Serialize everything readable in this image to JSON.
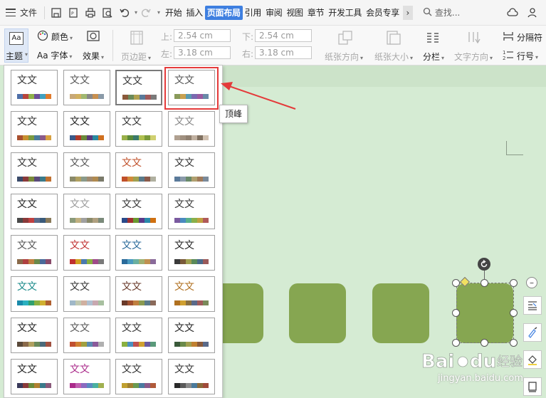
{
  "menubar": {
    "file_label": "文件",
    "tabs": [
      "开始",
      "插入",
      "页面布局",
      "引用",
      "审阅",
      "视图",
      "章节",
      "开发工具",
      "会员专享"
    ],
    "active_tab": "页面布局",
    "search_label": "查找..."
  },
  "ribbon": {
    "theme_icon_text": "Aa",
    "theme_label": "主题",
    "color_label": "颜色",
    "font_label": "字体",
    "font_prefix": "Aa",
    "effect_label": "效果",
    "margins_label": "页边距",
    "margin_top_label": "上:",
    "margin_top_value": "2.54 cm",
    "margin_left_label": "左:",
    "margin_left_value": "3.18 cm",
    "margin_bottom_label": "下:",
    "margin_bottom_value": "2.54 cm",
    "margin_right_label": "右:",
    "margin_right_value": "3.18 cm",
    "orientation_label": "纸张方向",
    "size_label": "纸张大小",
    "columns_label": "分栏",
    "text_direction_label": "文字方向",
    "break_label": "分隔符",
    "line_number_label": "行号"
  },
  "theme_panel": {
    "tile_text": "文文",
    "tooltip": "顶峰",
    "tiles": [
      {
        "color": "#333333",
        "sw": [
          "#4e6fa8",
          "#b8453c",
          "#8fb04a",
          "#6c4f98",
          "#40a0c0",
          "#e07a2c"
        ]
      },
      {
        "color": "#555555",
        "sw": [
          "#c8a878",
          "#d0b060",
          "#a0b870",
          "#888888",
          "#c89050",
          "#8a9aa8"
        ]
      },
      {
        "color": "#333333",
        "sw": [
          "#8a5a3a",
          "#6a8a5a",
          "#b0a050",
          "#5a7a9a",
          "#a05a5a",
          "#7a7a7a"
        ]
      },
      {
        "color": "#555555",
        "sw": [
          "#8a9a5a",
          "#c8a050",
          "#5a9ab0",
          "#7a6ab0",
          "#9a5aa0",
          "#6a8aa8"
        ]
      },
      {
        "color": "#333333",
        "sw": [
          "#a85030",
          "#c89030",
          "#7a9a40",
          "#4a7a9a",
          "#8a5a8a",
          "#d8a040"
        ]
      },
      {
        "color": "#222222",
        "sw": [
          "#3a5a8a",
          "#b03a2a",
          "#6a8a3a",
          "#5a3a7a",
          "#2a8aa0",
          "#d07020"
        ]
      },
      {
        "color": "#333333",
        "sw": [
          "#9ab04a",
          "#5a8a3a",
          "#3a7a6a",
          "#b0c050",
          "#7a9a3a",
          "#d0d070"
        ]
      },
      {
        "color": "#888888",
        "sw": [
          "#b0a090",
          "#a09080",
          "#908070",
          "#c0b0a0",
          "#807060",
          "#d0c0b0"
        ]
      },
      {
        "color": "#333333",
        "sw": [
          "#3a4a6a",
          "#8a3a3a",
          "#7a8a3a",
          "#5a4a7a",
          "#3a7a8a",
          "#c07030"
        ]
      },
      {
        "color": "#555555",
        "sw": [
          "#8a8a6a",
          "#b0a060",
          "#8a9a8a",
          "#a08a70",
          "#b08a50",
          "#7a7a6a"
        ]
      },
      {
        "color": "#c0502a",
        "sw": [
          "#c0502a",
          "#d08a3a",
          "#a0a050",
          "#5a7a8a",
          "#8a5a4a",
          "#b0b0a0"
        ]
      },
      {
        "color": "#333333",
        "sw": [
          "#5a7a9a",
          "#8a9aaa",
          "#6a8a6a",
          "#b0a070",
          "#a07a5a",
          "#7a8a9a"
        ]
      },
      {
        "color": "#222222",
        "sw": [
          "#4a4a4a",
          "#8a3a3a",
          "#c04040",
          "#5a6a8a",
          "#3a5a7a",
          "#8a7a5a"
        ]
      },
      {
        "color": "#999999",
        "sw": [
          "#8a9a7a",
          "#c0b080",
          "#a0a0a0",
          "#8a8a6a",
          "#b0a080",
          "#7a8a7a"
        ]
      },
      {
        "color": "#333333",
        "sw": [
          "#2a4a8a",
          "#a03030",
          "#6a9a30",
          "#5a3a8a",
          "#2a8aaa",
          "#d07010"
        ]
      },
      {
        "color": "#333333",
        "sw": [
          "#7a5aa0",
          "#4a8ac0",
          "#5ab08a",
          "#8ab04a",
          "#c0a040",
          "#b05a5a"
        ]
      },
      {
        "color": "#555555",
        "sw": [
          "#8a6a4a",
          "#b04040",
          "#c08040",
          "#6a8a4a",
          "#4a6a9a",
          "#8a4a6a"
        ]
      },
      {
        "color": "#c03030",
        "sw": [
          "#c03030",
          "#d0a020",
          "#4a7ab0",
          "#8ab040",
          "#a04a8a",
          "#7a7a7a"
        ]
      },
      {
        "color": "#2a6a9a",
        "sw": [
          "#2a6a9a",
          "#4a9ac0",
          "#6ab0a0",
          "#a0b070",
          "#c09050",
          "#8a6a9a"
        ]
      },
      {
        "color": "#222222",
        "sw": [
          "#3a3a3a",
          "#7a5a3a",
          "#a0a050",
          "#5a8a5a",
          "#4a6a8a",
          "#9a5a5a"
        ]
      },
      {
        "color": "#1a8a8a",
        "sw": [
          "#1a8aaa",
          "#2ab0c0",
          "#30a070",
          "#8ab040",
          "#d0b030",
          "#b06030"
        ]
      },
      {
        "color": "#333333",
        "sw": [
          "#a0b8c8",
          "#c0c8b0",
          "#d0b0a0",
          "#b0c0d0",
          "#c8a8b0",
          "#a8c0a0"
        ]
      },
      {
        "color": "#6a3a2a",
        "sw": [
          "#6a3a2a",
          "#a05030",
          "#c08040",
          "#8a9a50",
          "#5a7a8a",
          "#8a6a5a"
        ]
      },
      {
        "color": "#b07020",
        "sw": [
          "#b07020",
          "#d0a030",
          "#8a7040",
          "#5a6a8a",
          "#a05a5a",
          "#7a8a5a"
        ]
      },
      {
        "color": "#222222",
        "sw": [
          "#5a4a3a",
          "#8a6a4a",
          "#b0a060",
          "#6a8a5a",
          "#4a6a7a",
          "#a05040"
        ]
      },
      {
        "color": "#555555",
        "sw": [
          "#c05030",
          "#d08030",
          "#a0a040",
          "#5a8ab0",
          "#8a5a9a",
          "#b0b0b0"
        ]
      },
      {
        "color": "#333333",
        "sw": [
          "#8ab040",
          "#4a90c0",
          "#c05050",
          "#d0a030",
          "#6a5aa0",
          "#5a9a7a"
        ]
      },
      {
        "color": "#222222",
        "sw": [
          "#3a5a3a",
          "#6a8a4a",
          "#a0a050",
          "#c08030",
          "#8a5a3a",
          "#5a6a8a"
        ]
      },
      {
        "color": "#222222",
        "sw": [
          "#3a3a5a",
          "#8a3a3a",
          "#6a8a3a",
          "#b08030",
          "#3a7a8a",
          "#8a5a7a"
        ]
      },
      {
        "color": "#aa2a8a",
        "sw": [
          "#aa2a8a",
          "#c060b0",
          "#8a6ac0",
          "#5a8ac0",
          "#4ab0a0",
          "#a0b050"
        ]
      },
      {
        "color": "#333333",
        "sw": [
          "#c0a030",
          "#a08030",
          "#6a9a50",
          "#4a7aa0",
          "#8a5a8a",
          "#b05a3a"
        ]
      },
      {
        "color": "#333333",
        "sw": [
          "#2a2a2a",
          "#5a5a5a",
          "#8a8a8a",
          "#4a7a9a",
          "#8a6a3a",
          "#a04a3a"
        ]
      }
    ]
  },
  "colors": {
    "accent": "#3e7fe0",
    "highlight": "#e43a3a",
    "canvas": "#d5ebd3",
    "shape": "#86a651"
  },
  "watermark": {
    "text": "jingyan.baidu.com"
  }
}
